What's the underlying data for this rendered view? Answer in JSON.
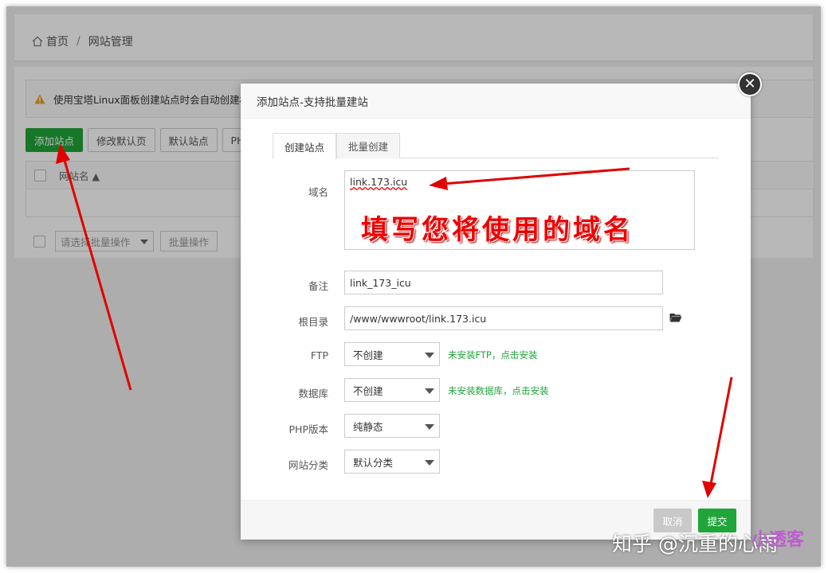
{
  "breadcrumb": {
    "home": "首页",
    "separator": "/",
    "current": "网站管理"
  },
  "notice": "使用宝塔Linux面板创建站点时会自动创建权",
  "toolbar": {
    "add_site": "添加站点",
    "modify_default": "修改默认页",
    "default_site": "默认站点",
    "php": "PHP"
  },
  "table": {
    "col_name": "网站名 ▲"
  },
  "batch": {
    "select_placeholder": "请选择批量操作",
    "apply": "批量操作"
  },
  "modal": {
    "title": "添加站点-支持批量建站",
    "tabs": [
      {
        "label": "创建站点"
      },
      {
        "label": "批量创建"
      }
    ],
    "domain": {
      "label": "域名",
      "value": "link.173.icu"
    },
    "remark": {
      "label": "备注",
      "value": "link_173_icu"
    },
    "root": {
      "label": "根目录",
      "value": "/www/wwwroot/link.173.icu"
    },
    "ftp": {
      "label": "FTP",
      "value": "不创建",
      "hint": "未安装FTP，点击安装"
    },
    "database": {
      "label": "数据库",
      "value": "不创建",
      "hint": "未安装数据库，点击安装"
    },
    "php": {
      "label": "PHP版本",
      "value": "纯静态"
    },
    "category": {
      "label": "网站分类",
      "value": "默认分类"
    },
    "cancel": "取消",
    "submit": "提交"
  },
  "annotation": "填写您将使用的域名",
  "watermark": {
    "text": "知乎 @沉重的心雨",
    "logo": "小透客"
  },
  "colors": {
    "accent": "#20a53a",
    "arrow": "#e00000"
  }
}
